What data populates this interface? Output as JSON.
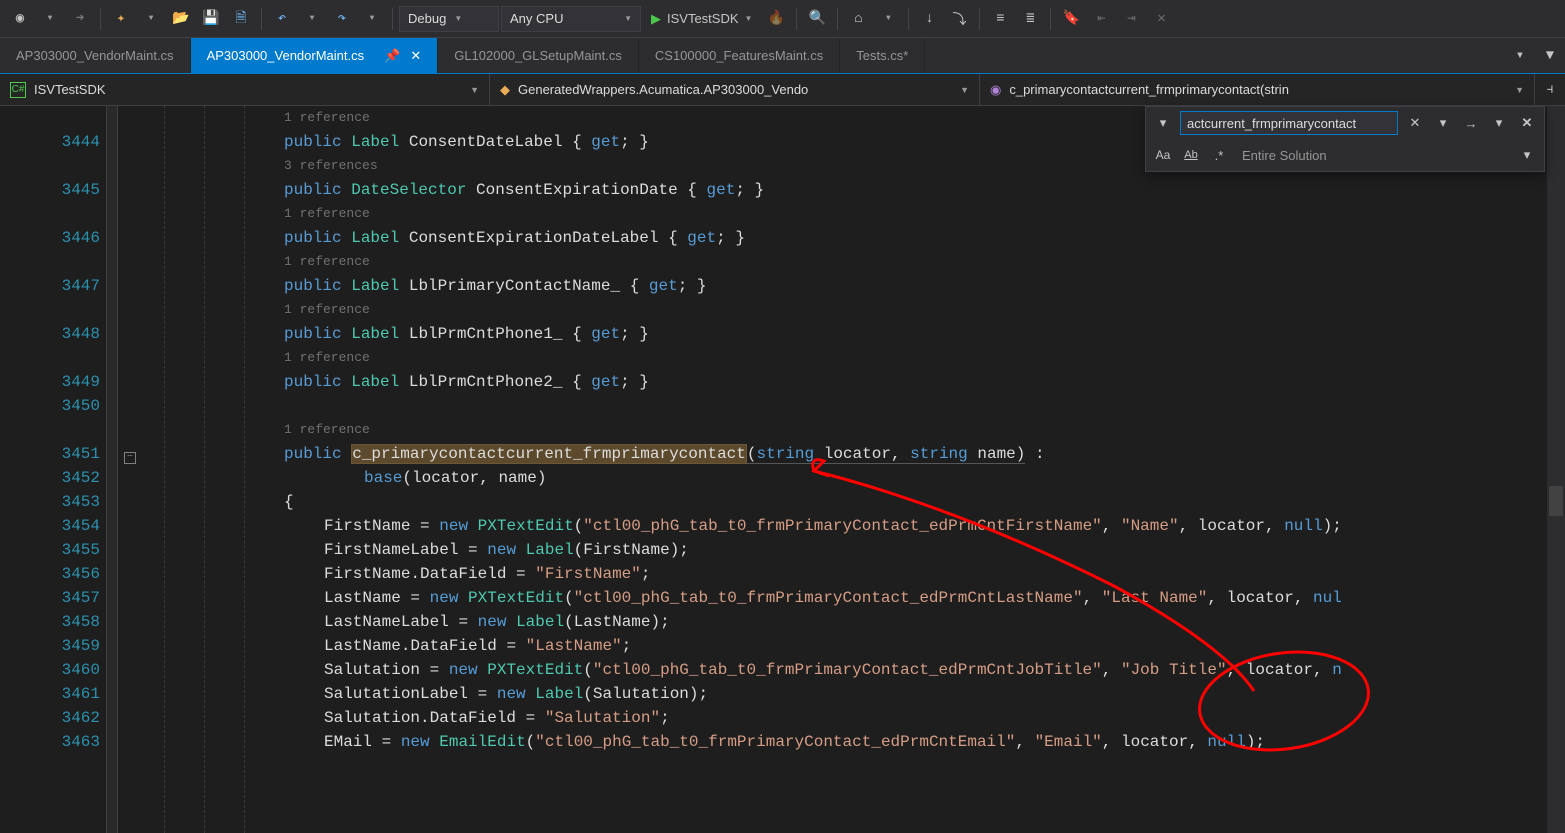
{
  "toolbar": {
    "config_dropdown": "Debug",
    "platform_dropdown": "Any CPU",
    "start_label": "ISVTestSDK"
  },
  "tabs": [
    {
      "label": "AP303000_VendorMaint.cs",
      "active": false,
      "pinned": false,
      "dirty": false
    },
    {
      "label": "AP303000_VendorMaint.cs",
      "active": true,
      "pinned": true,
      "dirty": false
    },
    {
      "label": "GL102000_GLSetupMaint.cs",
      "active": false,
      "pinned": false,
      "dirty": false
    },
    {
      "label": "CS100000_FeaturesMaint.cs",
      "active": false,
      "pinned": false,
      "dirty": false
    },
    {
      "label": "Tests.cs*",
      "active": false,
      "pinned": false,
      "dirty": true
    }
  ],
  "navbar": {
    "project": "ISVTestSDK",
    "class": "GeneratedWrappers.Acumatica.AP303000_Vendo",
    "member": "c_primarycontactcurrent_frmprimarycontact(strin"
  },
  "find": {
    "term": "actcurrent_frmprimarycontact",
    "scope": "Entire Solution"
  },
  "codelens": {
    "one_ref": "1 reference",
    "three_refs": "3 references"
  },
  "line_numbers": [
    "3444",
    "3445",
    "3446",
    "3447",
    "3448",
    "3449",
    "3450",
    "3451",
    "3452",
    "3453",
    "3454",
    "3455",
    "3456",
    "3457",
    "3458",
    "3459",
    "3460",
    "3461",
    "3462",
    "3463"
  ],
  "code": {
    "l3444": {
      "kw": "public",
      "type": "Label",
      "name": "ConsentDateLabel",
      "acc": "get"
    },
    "l3445": {
      "kw": "public",
      "type": "DateSelector",
      "name": "ConsentExpirationDate",
      "acc": "get"
    },
    "l3446": {
      "kw": "public",
      "type": "Label",
      "name": "ConsentExpirationDateLabel",
      "acc": "get"
    },
    "l3447": {
      "kw": "public",
      "type": "Label",
      "name": "LblPrimaryContactName_",
      "acc": "get"
    },
    "l3448": {
      "kw": "public",
      "type": "Label",
      "name": "LblPrmCntPhone1_",
      "acc": "get"
    },
    "l3449": {
      "kw": "public",
      "type": "Label",
      "name": "LblPrmCntPhone2_",
      "acc": "get"
    },
    "l3451": {
      "kw": "public",
      "ctor": "c_primarycontactcurrent_frmprimarycontact",
      "p1t": "string",
      "p1n": "locator",
      "p2t": "string",
      "p2n": "name"
    },
    "l3452": {
      "kw": "base",
      "a1": "locator",
      "a2": "name"
    },
    "l3453": {
      "brace": "{"
    },
    "l3454": {
      "lhs": "FirstName",
      "op": "new",
      "type": "PXTextEdit",
      "s1": "\"ctl00_phG_tab_t0_frmPrimaryContact_edPrmCntFirstName\"",
      "s2": "\"Name\"",
      "a3": "locator",
      "a4": "null"
    },
    "l3455": {
      "lhs": "FirstNameLabel",
      "op": "new",
      "type": "Label",
      "a1": "FirstName"
    },
    "l3456": {
      "lhs": "FirstName.DataField",
      "s1": "\"FirstName\""
    },
    "l3457": {
      "lhs": "LastName",
      "op": "new",
      "type": "PXTextEdit",
      "s1": "\"ctl00_phG_tab_t0_frmPrimaryContact_edPrmCntLastName\"",
      "s2": "\"Last Name\"",
      "a3": "locator",
      "a4": "nul"
    },
    "l3458": {
      "lhs": "LastNameLabel",
      "op": "new",
      "type": "Label",
      "a1": "LastName"
    },
    "l3459": {
      "lhs": "LastName.DataField",
      "s1": "\"LastName\""
    },
    "l3460": {
      "lhs": "Salutation",
      "op": "new",
      "type": "PXTextEdit",
      "s1": "\"ctl00_phG_tab_t0_frmPrimaryContact_edPrmCntJobTitle\"",
      "s2": "\"Job Title\"",
      "a3": "locator",
      "a4": "n"
    },
    "l3461": {
      "lhs": "SalutationLabel",
      "op": "new",
      "type": "Label",
      "a1": "Salutation"
    },
    "l3462": {
      "lhs": "Salutation.DataField",
      "s1": "\"Salutation\""
    },
    "l3463": {
      "lhs": "EMail",
      "op": "new",
      "type": "EmailEdit",
      "s1": "\"ctl00_phG_tab_t0_frmPrimaryContact_edPrmCntEmail\"",
      "s2": "\"Email\"",
      "a3": "locator",
      "a4": "null"
    }
  }
}
